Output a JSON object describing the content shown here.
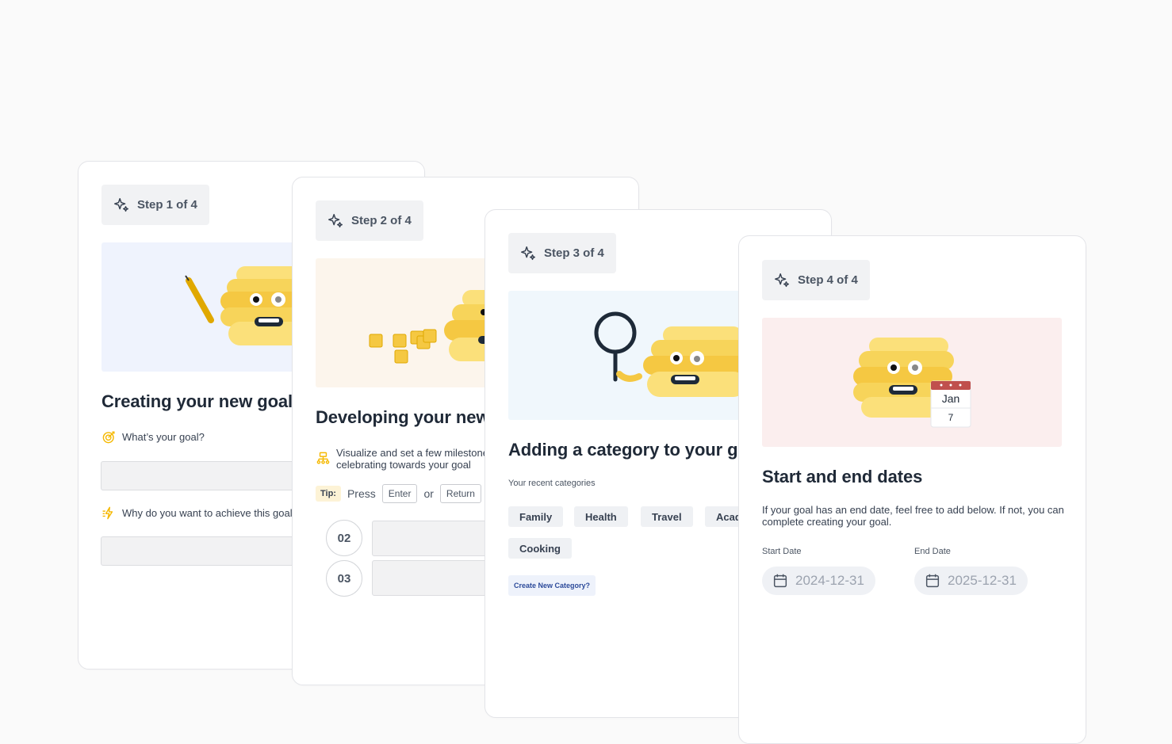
{
  "cards": [
    {
      "step": "Step 1 of 4",
      "title": "Creating your new goal",
      "question1": "What’s your goal?",
      "question2": "Why do you want to achieve this goal?",
      "hero_color": "#eff3fd"
    },
    {
      "step": "Step 2 of 4",
      "title": "Developing your new milestones",
      "description": "Visualize and set a few milestones worth celebrating towards your goal",
      "tip_label": "Tip:",
      "tip_press": "Press",
      "key_enter": "Enter",
      "tip_or": "or",
      "key_return": "Return",
      "milestones": [
        "02",
        "03"
      ],
      "hero_color": "#fcf5ec"
    },
    {
      "step": "Step 3 of 4",
      "title": "Adding a category to your goal",
      "recent_label": "Your recent categories",
      "categories": [
        "Family",
        "Health",
        "Travel",
        "Academics",
        "Cooking"
      ],
      "create_label": "Create New Category?",
      "hero_color": "#f0f7fc"
    },
    {
      "step": "Step 4 of 4",
      "title": "Start and end dates",
      "description": "If your goal has an end date, feel free to add below. If not, you can complete creating your goal.",
      "start_label": "Start Date",
      "end_label": "End Date",
      "start_value": "2024-12-31",
      "end_value": "2025-12-31",
      "calendar_month": "Jan",
      "calendar_day": "7",
      "hero_color": "#fbeeee"
    }
  ],
  "colors": {
    "accent_yellow": "#f5c842",
    "calendar_red": "#c0504d",
    "link_blue": "#2c4a9a"
  }
}
